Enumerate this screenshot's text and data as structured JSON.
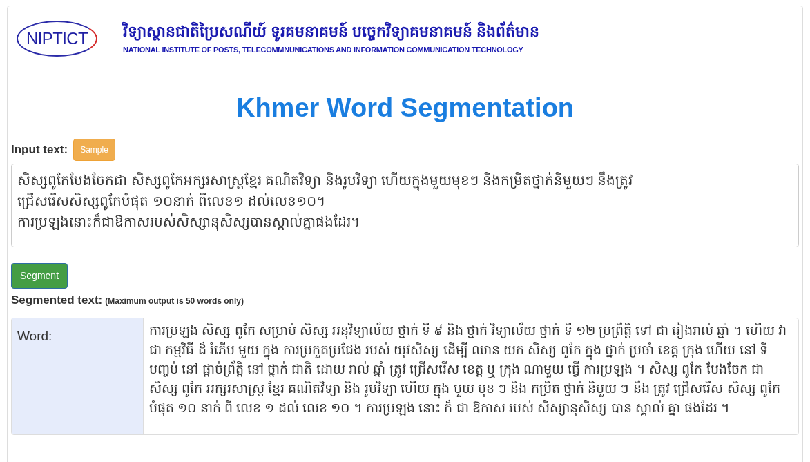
{
  "header": {
    "logo_text": "NIPTICT",
    "title_khmer": "វិទ្យាស្ថានជាតិប្រៃសណីយ៍ ទូរគមនាគមន៍ បច្ចេកវិទ្យាគមនាគមន៍ និងព័ត៌មាន",
    "title_english": "NATIONAL INSTITUTE OF POSTS, TELECOMMNUNICATIONS AND INFORMATION COMMUNICATION TECHNOLOGY"
  },
  "page_title": "Khmer Word Segmentation",
  "input": {
    "label": "Input text:",
    "sample_button": "Sample",
    "lines": [
      "សិស្សពូកែបែងចែកជា សិស្សពូកែអក្សរសាស្ត្រខ្មែរ គណិតវិទ្យា និងរូបវិទ្យា ហើយក្នុងមួយមុខៗ និងកម្រិតថ្នាក់និមួយៗ នឹងត្រូវ",
      "ជ្រើសរើសសិស្សពូកែបំផុត ១០នាក់ ពីលេខ១ ដល់លេខ១០។",
      "ការប្រឡងនោះក៏ជាឱកាសរបស់សិស្សានុសិស្សបានស្គាល់គ្នាផងដែរ។"
    ]
  },
  "segment_button": "Segment",
  "output": {
    "label": "Segmented text:",
    "note": "(Maximum output is 50 words only)",
    "row_label": "Word:",
    "text": "ការប្រឡង សិស្ស ពូកែ សម្រាប់ សិស្ស អនុវិទ្យាល័យ ថ្នាក់ ទី ៩ និង ថ្នាក់ វិទ្យាល័យ ថ្នាក់ ទី ១២ ប្រព្រឹត្ដិ ទៅ ជា រៀងរាល់ ឆ្នាំ ។ ហើយ វា ជា កម្មវិធី ដ៏ រំភើប មួយ ក្នុង ការប្រកួតប្រជែង របស់ យុវសិស្ស ដើម្បី ឈាន យក សិស្ស ពូកែ ក្នុង ថ្នាក់ ប្រចាំ ខេត្ត ក្រុង ហើយ នៅ ទីបញ្ចប់ នៅ ផ្តាច់ព្រ័ត្តិ នៅ ថ្នាក់ ជាតិ ដោយ រាល់ ឆ្នាំ ត្រូវ ជ្រើសរើស ខេត្ត ឬ ក្រុង ណាមួយ ធ្វើ ការប្រឡង ។ សិស្ស ពូកែ បែងចែក ជា សិស្ស ពូកែ អក្សរសាស្ត្រ ខ្មែរ គណិតវិទ្យា និង រូបវិទ្យា ហើយ ក្នុង មួយ មុខ ៗ និង កម្រិត ថ្នាក់ និមួយ ៗ នឹង ត្រូវ ជ្រើសរើស សិស្ស ពូកែ បំផុត ១០ នាក់ ពី លេខ ១ ដល់ លេខ ១០ ។ ការប្រឡង នោះ ក៏ ជា ឱកាស របស់ សិស្សានុសិស្ស បាន ស្គាល់ គ្នា ផងដែរ ។"
  }
}
